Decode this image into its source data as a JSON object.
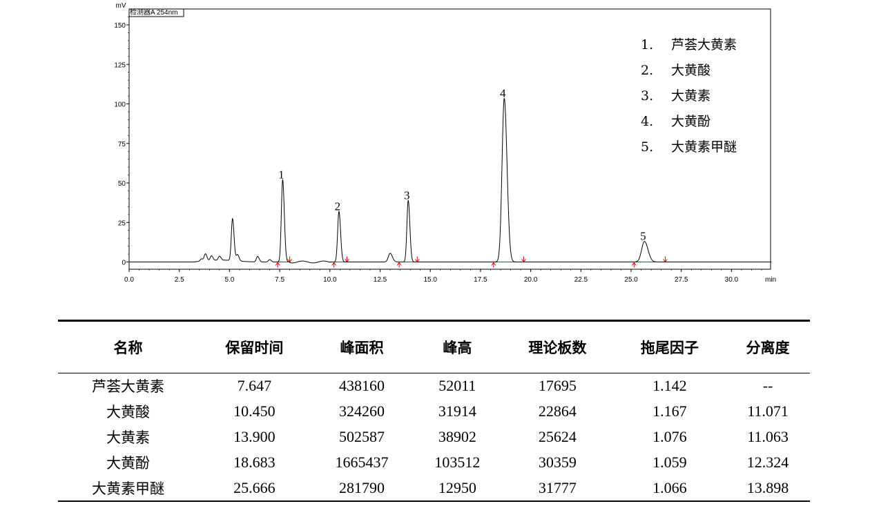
{
  "chart_data": {
    "type": "line",
    "detector_label": "检测器A 254nm",
    "y_unit": "mV",
    "x_unit": "min",
    "xlim": [
      0,
      32
    ],
    "ylim": [
      -5,
      160
    ],
    "x_ticks": [
      "0.0",
      "2.5",
      "5.0",
      "7.5",
      "10.0",
      "12.5",
      "15.0",
      "17.5",
      "20.0",
      "22.5",
      "25.0",
      "27.5",
      "30.0"
    ],
    "y_ticks": [
      "0",
      "25",
      "50",
      "75",
      "100",
      "125",
      "150"
    ],
    "peaks": [
      {
        "label": "1",
        "rt": 7.647,
        "height": 52.0
      },
      {
        "label": "2",
        "rt": 10.45,
        "height": 31.9
      },
      {
        "label": "3",
        "rt": 13.9,
        "height": 38.9
      },
      {
        "label": "4",
        "rt": 18.683,
        "height": 103.5
      },
      {
        "label": "5",
        "rt": 25.666,
        "height": 13.0
      }
    ],
    "minor_peaks": [
      {
        "rt": 3.6,
        "height": 1.5
      },
      {
        "rt": 3.8,
        "height": 4.5
      },
      {
        "rt": 4.1,
        "height": 3.0
      },
      {
        "rt": 4.5,
        "height": 2.5
      },
      {
        "rt": 5.15,
        "height": 26.5
      },
      {
        "rt": 5.4,
        "height": 4.0
      },
      {
        "rt": 6.4,
        "height": 3.5
      },
      {
        "rt": 7.0,
        "height": 1.5
      },
      {
        "rt": 13.0,
        "height": 5.5
      }
    ],
    "integration_marks": [
      [
        7.4,
        8.0
      ],
      [
        10.2,
        10.85
      ],
      [
        13.45,
        14.35
      ],
      [
        18.15,
        19.65
      ],
      [
        25.15,
        26.7
      ]
    ],
    "legend": [
      {
        "num": "1.",
        "name": "芦荟大黄素"
      },
      {
        "num": "2.",
        "name": "大黄酸"
      },
      {
        "num": "3.",
        "name": "大黄素"
      },
      {
        "num": "4.",
        "name": "大黄酚"
      },
      {
        "num": "5.",
        "name": "大黄素甲醚"
      }
    ]
  },
  "table": {
    "headers": [
      "名称",
      "保留时间",
      "峰面积",
      "峰高",
      "理论板数",
      "拖尾因子",
      "分离度"
    ],
    "rows": [
      [
        "芦荟大黄素",
        "7.647",
        "438160",
        "52011",
        "17695",
        "1.142",
        "--"
      ],
      [
        "大黄酸",
        "10.450",
        "324260",
        "31914",
        "22864",
        "1.167",
        "11.071"
      ],
      [
        "大黄素",
        "13.900",
        "502587",
        "38902",
        "25624",
        "1.076",
        "11.063"
      ],
      [
        "大黄酚",
        "18.683",
        "1665437",
        "103512",
        "30359",
        "1.059",
        "12.324"
      ],
      [
        "大黄素甲醚",
        "25.666",
        "281790",
        "12950",
        "31777",
        "1.066",
        "13.898"
      ]
    ]
  }
}
